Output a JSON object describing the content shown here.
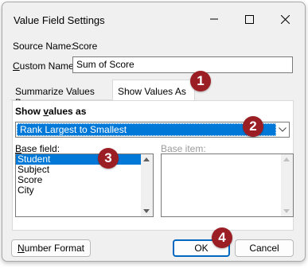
{
  "window": {
    "title": "Value Field Settings"
  },
  "source": {
    "label": "Source Name:",
    "value": "Score"
  },
  "custom_name": {
    "label_u": "C",
    "label_rest": "ustom Name:",
    "value": "Sum of Score"
  },
  "tabs": [
    {
      "label": "Summarize Values By",
      "active": false
    },
    {
      "label": "Show Values As",
      "active": true
    }
  ],
  "show_values": {
    "label_a": "Show ",
    "label_u": "v",
    "label_b": "alues as",
    "selected": "Rank Largest to Smallest"
  },
  "base_field": {
    "label_u": "B",
    "label_rest": "ase field:",
    "items": [
      "Student",
      "Subject",
      "Score",
      "City"
    ],
    "selected_index": 0
  },
  "base_item": {
    "label": "Base item:",
    "items": []
  },
  "buttons": {
    "number_format_u": "N",
    "number_format_rest": "umber Format",
    "ok": "OK",
    "cancel": "Cancel"
  },
  "badges": [
    "1",
    "2",
    "3",
    "4"
  ],
  "colors": {
    "accent": "#0078d7",
    "badge": "#9b1e24"
  }
}
